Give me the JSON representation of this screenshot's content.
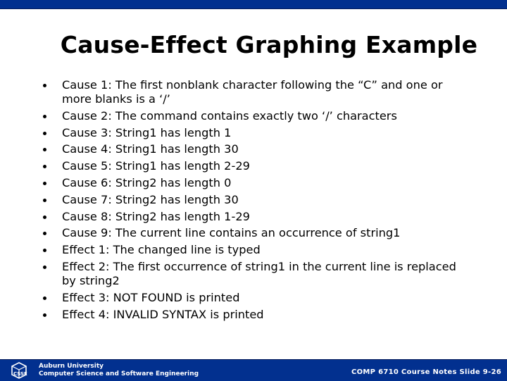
{
  "slide": {
    "title": "Cause-Effect Graphing Example",
    "bullets": [
      {
        "text": "Cause 1: The first nonblank character following the “C” and one or more blanks is a ‘/’"
      },
      {
        "text": "Cause 2: The command contains exactly two ‘/’ characters"
      },
      {
        "text": "Cause 3: String1 has length 1"
      },
      {
        "text": "Cause 4: String1 has length 30"
      },
      {
        "text": "Cause 5: String1 has length 2-29"
      },
      {
        "text": "Cause 6: String2 has length 0"
      },
      {
        "text": "Cause 7: String2 has length 30"
      },
      {
        "text": "Cause 8: String2 has length 1-29"
      },
      {
        "text": "Cause 9: The current line contains an occurrence of string1"
      },
      {
        "text": "Effect 1: The changed line is typed"
      },
      {
        "text": "Effect 2: The first occurrence of string1 in the current line is replaced by string2"
      },
      {
        "text": "Effect 3: NOT FOUND is printed"
      },
      {
        "text": "Effect 4: INVALID SYNTAX is printed"
      }
    ]
  },
  "footer": {
    "logo_icon": "csse-cube-logo",
    "institution_line1": "Auburn University",
    "institution_line2": "Computer Science and Software Engineering",
    "course_slide": "COMP 6710 Course Notes Slide 9-26"
  },
  "colors": {
    "bar_blue": "#02308f",
    "text": "#000000",
    "footer_text": "#ffffff"
  }
}
